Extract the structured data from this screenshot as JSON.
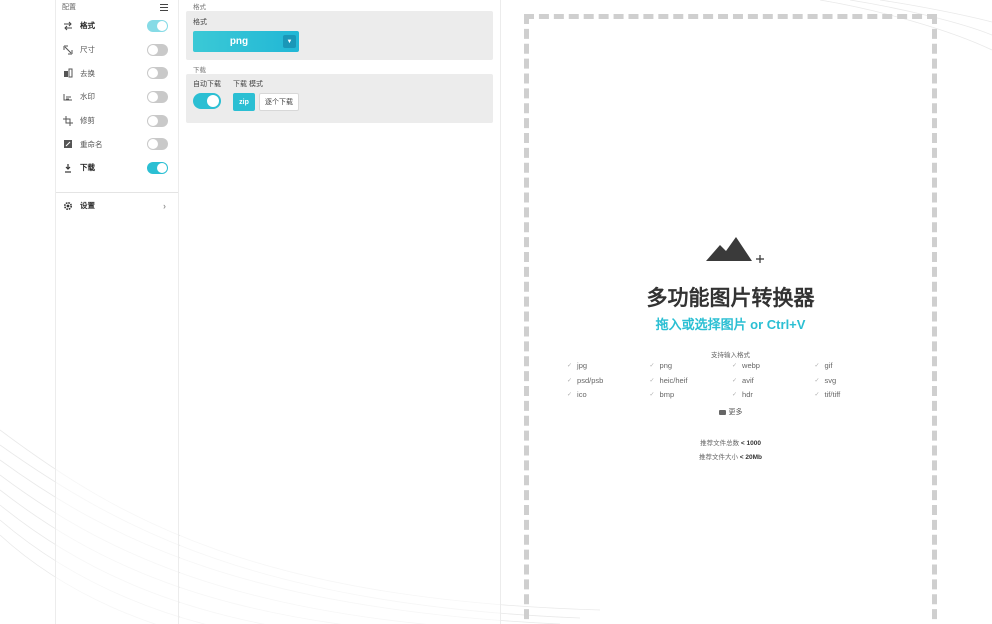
{
  "sidebar": {
    "title": "配置",
    "items": [
      {
        "label": "格式",
        "icon": "swap-icon",
        "toggle": true,
        "active": true
      },
      {
        "label": "尺寸",
        "icon": "resize-icon",
        "toggle": false,
        "active": false
      },
      {
        "label": "去换",
        "icon": "replace-icon",
        "toggle": false,
        "active": false
      },
      {
        "label": "水印",
        "icon": "watermark-icon",
        "toggle": false,
        "active": false
      },
      {
        "label": "修剪",
        "icon": "crop-icon",
        "toggle": false,
        "active": false
      },
      {
        "label": "重命名",
        "icon": "rename-icon",
        "toggle": false,
        "active": false
      },
      {
        "label": "下载",
        "icon": "download-icon",
        "toggle": true,
        "active": true
      }
    ],
    "settings_label": "设置"
  },
  "format_section": {
    "title": "格式",
    "field_label": "格式",
    "selected": "png"
  },
  "download_section": {
    "title": "下载",
    "auto_label": "自动下载",
    "mode_label": "下载 模式",
    "zip_label": "zip",
    "single_label": "逐个下载"
  },
  "dropzone": {
    "title": "多功能图片转换器",
    "subtitle": "拖入或选择图片 or Ctrl+V",
    "formats_title": "支持输入格式",
    "formats": [
      "jpg",
      "png",
      "webp",
      "gif",
      "psd/psb",
      "heic/heif",
      "avif",
      "svg",
      "ico",
      "bmp",
      "hdr",
      "tif/tiff"
    ],
    "more_label": "更多",
    "limit_count_label": "推荐文件总数",
    "limit_count_value": "< 1000",
    "limit_size_label": "推荐文件大小",
    "limit_size_value": "< 20Mb"
  },
  "colors": {
    "accent": "#2bbfd3",
    "toggle_off": "#c9c9c9",
    "dash": "#cfcfcf"
  }
}
